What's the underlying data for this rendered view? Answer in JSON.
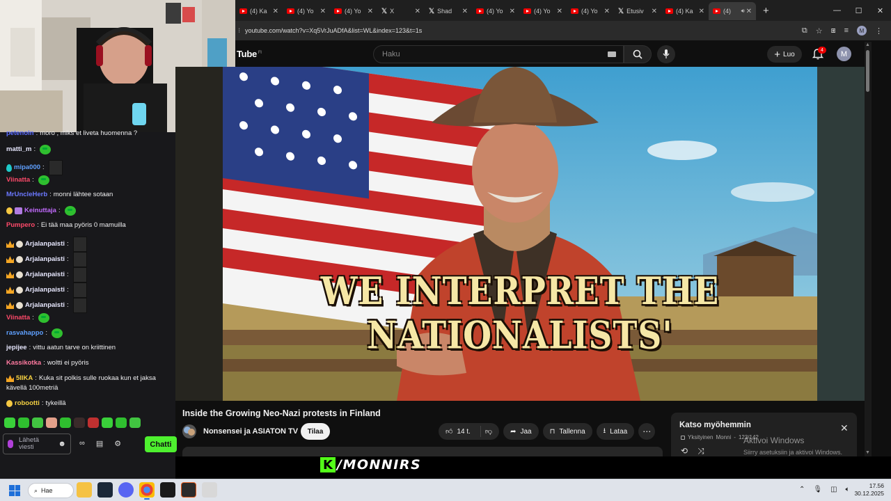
{
  "browser": {
    "tabs": [
      {
        "icon": "youtube",
        "label": "(4) Ka"
      },
      {
        "icon": "youtube",
        "label": "(4) Yo"
      },
      {
        "icon": "youtube",
        "label": "(4) Yo"
      },
      {
        "icon": "x",
        "label": "X"
      },
      {
        "icon": "x",
        "label": "Shad"
      },
      {
        "icon": "youtube",
        "label": "(4) Yo"
      },
      {
        "icon": "youtube",
        "label": "(4) Yo"
      },
      {
        "icon": "youtube",
        "label": "(4) Yo"
      },
      {
        "icon": "x",
        "label": "Etusiv"
      },
      {
        "icon": "youtube",
        "label": "(4) Ka"
      },
      {
        "icon": "youtube",
        "label": "(4)",
        "active": true
      }
    ],
    "url": "youtube.com/watch?v=Xq5VrJuADfA&list=WL&index=123&t=1s"
  },
  "youtube": {
    "logo_text": "Tube",
    "logo_region": "FI",
    "search_placeholder": "Haku",
    "create_label": "Luo",
    "notification_count": "4",
    "avatar_letter": "M"
  },
  "video": {
    "overlay_caption": "WE INTERPRET THE NATIONALISTS'",
    "title": "Inside the Growing Neo-Nazi protests in Finland",
    "channel": "Nonsensei ja ASIATON TV",
    "subscribe_label": "Tilaa",
    "likes": "14 t.",
    "share_label": "Jaa",
    "save_label": "Tallenna",
    "download_label": "Lataa"
  },
  "watch_later": {
    "title": "Katso myöhemmin",
    "privacy": "Yksityinen",
    "owner": "Monni",
    "position": "123/142"
  },
  "windows_activation": {
    "line1": "Aktivoi Windows",
    "line2": "Siirry asetuksiin ja aktivoi Windows."
  },
  "chat": {
    "messages": [
      {
        "user": "petenoln",
        "color": "#5b6cff",
        "text": "moro , miks et liveta huomenna ?"
      },
      {
        "user": "matti_m",
        "color": "#e8e8ff",
        "text": ""
      },
      {
        "user": "mipa000",
        "color": "#5fa0ff",
        "text": ""
      },
      {
        "user": "Viinatta",
        "color": "#ff4a6a",
        "text": ""
      },
      {
        "user": "MrUncleHerb",
        "color": "#6b78ff",
        "text": "monni lähtee sotaan"
      },
      {
        "user": "Keinuttaja",
        "color": "#c36bff",
        "text": ""
      },
      {
        "user": "Pumpero",
        "color": "#ff4a6a",
        "text": "Ei tää maa pyöris 0 mamuilla"
      },
      {
        "user": "Arjalanpaisti",
        "color": "#e8e8ff",
        "text": ""
      },
      {
        "user": "Arjalanpaisti",
        "color": "#e8e8ff",
        "text": ""
      },
      {
        "user": "Arjalanpaisti",
        "color": "#e8e8ff",
        "text": ""
      },
      {
        "user": "Arjalanpaisti",
        "color": "#e8e8ff",
        "text": ""
      },
      {
        "user": "Arjalanpaisti",
        "color": "#e8e8ff",
        "text": ""
      },
      {
        "user": "Viinatta",
        "color": "#ff4a6a",
        "text": ""
      },
      {
        "user": "rasvahappo",
        "color": "#5fa0ff",
        "text": ""
      },
      {
        "user": "jepijee",
        "color": "#e8e8ff",
        "text": "vittu aatun tarve on kriittinen"
      },
      {
        "user": "Kassikotka",
        "color": "#ff7aa0",
        "text": "woltti ei pyöris"
      },
      {
        "user": "5IIKA",
        "color": "#f5d142",
        "text": "Kuka sit polkis sulle ruokaa kun et jaksa"
      },
      {
        "user": "",
        "color": "#efeff1",
        "text": "kävellä 100metriä"
      },
      {
        "user": "robootti",
        "color": "#f5d142",
        "text": "tykeillä"
      }
    ],
    "input_placeholder_1": "Lähetä",
    "input_placeholder_2": "viesti",
    "send_button": "Chatti"
  },
  "stream_banner": {
    "logo_letter": "K",
    "handle": "/MONNIRS"
  },
  "taskbar": {
    "search_label": "Hae",
    "time": "17.56",
    "date": "30.12.2025"
  }
}
